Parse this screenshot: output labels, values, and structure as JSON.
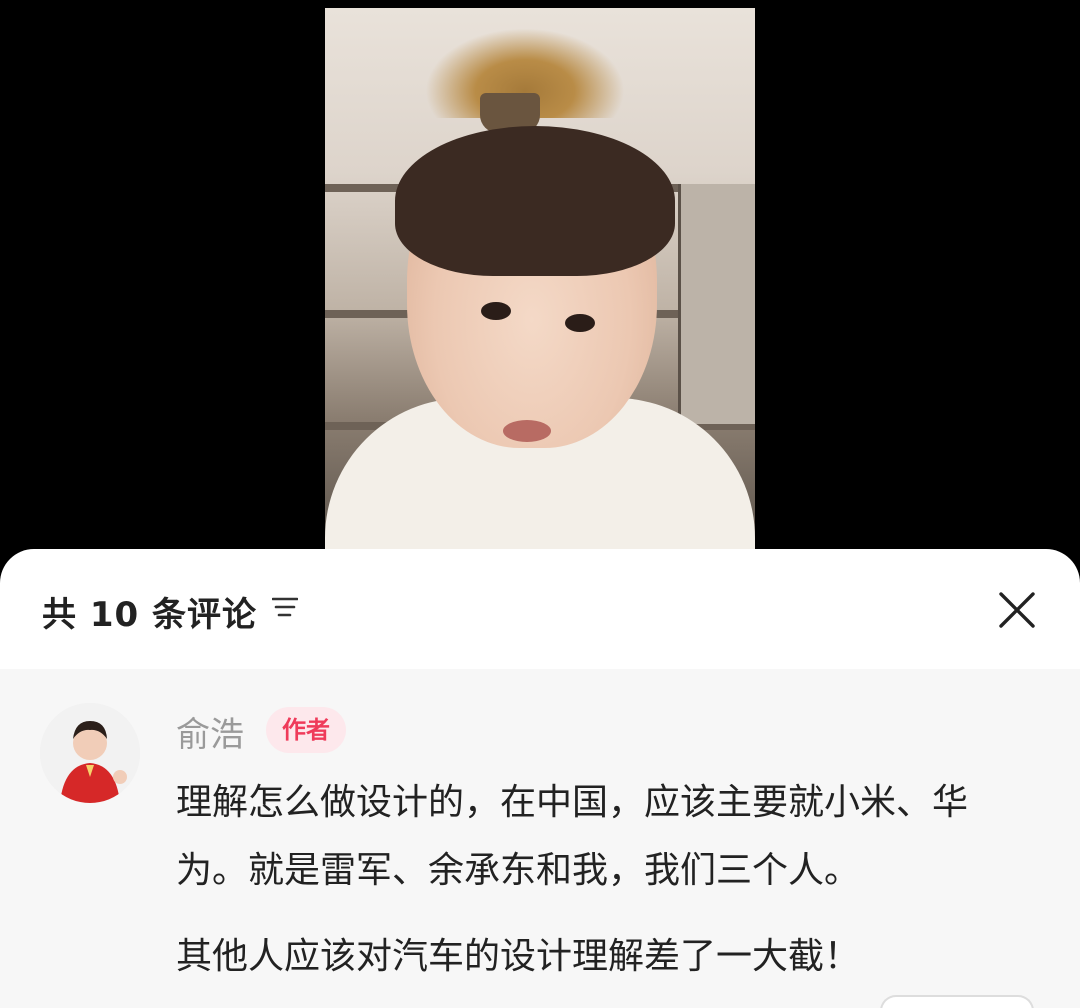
{
  "comments_panel": {
    "header": {
      "count_label": "共 10 条评论",
      "sort_icon": "sort-lines-icon",
      "close_icon": "close-icon"
    },
    "comment": {
      "author_name": "俞浩",
      "author_badge": "作者",
      "paragraphs": [
        "理解怎么做设计的，在中国，应该主要就小米、华为。就是雷军、余承东和我，我们三个人。",
        "其他人应该对汽车的设计理解差了一大截！"
      ]
    }
  },
  "colors": {
    "badge_text": "#ef3b5a",
    "badge_bg": "#fde8ec",
    "panel_bg": "#ffffff",
    "comment_bg": "#f7f7f7"
  }
}
